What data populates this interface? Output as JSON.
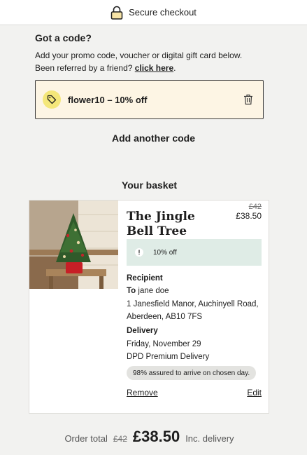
{
  "header": {
    "title": "Secure checkout",
    "icon": "lock-icon"
  },
  "promo": {
    "heading": "Got a code?",
    "line1": "Add your promo code, voucher or digital gift card below.",
    "line2_prefix": "Been referred by a friend?",
    "line2_link": "click here",
    "line2_suffix": ".",
    "applied_code": "flower10 – 10% off",
    "tag_icon": "tag-icon",
    "delete_icon": "trash-icon",
    "add_another": "Add another code"
  },
  "basket": {
    "heading": "Your basket",
    "item": {
      "name": "The Jingle Bell Tree",
      "price_old": "£42",
      "price_new": "£38.50",
      "discount_label": "10% off",
      "recipient_label": "Recipient",
      "recipient_to": "To",
      "recipient_name": "jane doe",
      "address_line1": "1 Janesfield Manor, Auchinyell Road,",
      "address_line2": "Aberdeen, AB10 7FS",
      "delivery_label": "Delivery",
      "delivery_date": "Friday, November 29",
      "delivery_method": "DPD Premium Delivery",
      "assured_text": "98% assured to arrive on chosen day.",
      "remove_label": "Remove",
      "edit_label": "Edit"
    }
  },
  "total": {
    "label": "Order total",
    "old": "£42",
    "new": "£38.50",
    "suffix": "Inc. delivery"
  },
  "colors": {
    "accent_yellow": "#f4e77a",
    "code_box_bg": "#fdf5e4",
    "discount_bg": "#dfece6"
  }
}
